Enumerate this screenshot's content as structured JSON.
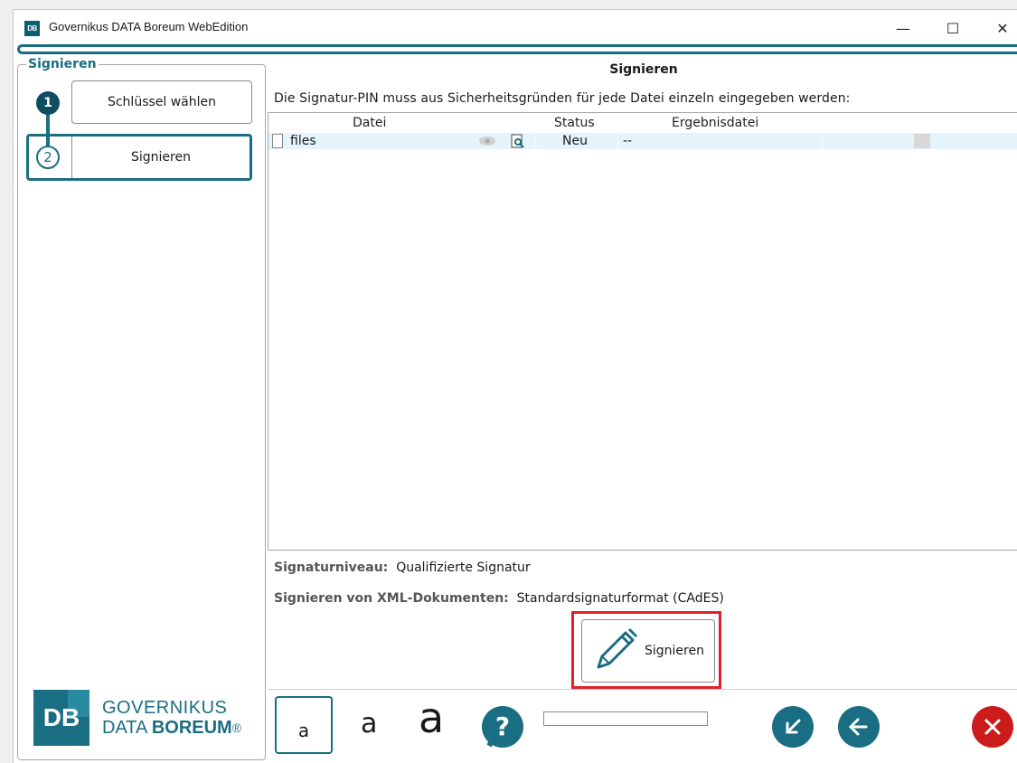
{
  "window": {
    "title": "Governikus DATA Boreum WebEdition",
    "app_icon_text": "DB",
    "controls": {
      "minimize": "—",
      "maximize": "☐",
      "close": "✕"
    }
  },
  "sidebar": {
    "legend": "Signieren",
    "steps": [
      {
        "number": "1",
        "label": "Schlüssel wählen",
        "state": "done"
      },
      {
        "number": "2",
        "label": "Signieren",
        "state": "active"
      }
    ],
    "brand": {
      "mark": "DB",
      "line1": "GOVERNIKUS",
      "line2_light": "DATA ",
      "line2_bold": "BOREUM",
      "reg": "®"
    }
  },
  "main": {
    "title": "Signieren",
    "instruction": "Die Signatur-PIN muss aus Sicherheitsgründen für jede Datei einzeln eingegeben werden:",
    "table": {
      "headers": {
        "file": "Datei",
        "status": "Status",
        "result": "Ergebnisdatei"
      },
      "rows": [
        {
          "file": "files",
          "status": "Neu",
          "result": "--"
        }
      ]
    },
    "signature_level_label": "Signaturniveau:",
    "signature_level_value": "Qualifizierte Signatur",
    "xml_label": "Signieren von XML-Dokumenten:",
    "xml_value": "Standardsignaturformat (CAdES)",
    "sign_button": "Signieren"
  },
  "toolbar": {
    "font_small": "a",
    "font_medium": "a",
    "font_large": "a",
    "icons": [
      "question-icon",
      "arrow-down-left-icon",
      "arrow-left-icon",
      "close-icon"
    ]
  },
  "colors": {
    "accent": "#1a6e83",
    "highlight": "#e0202a",
    "danger": "#cc1b1b",
    "row_selected": "#e5f3fb"
  }
}
